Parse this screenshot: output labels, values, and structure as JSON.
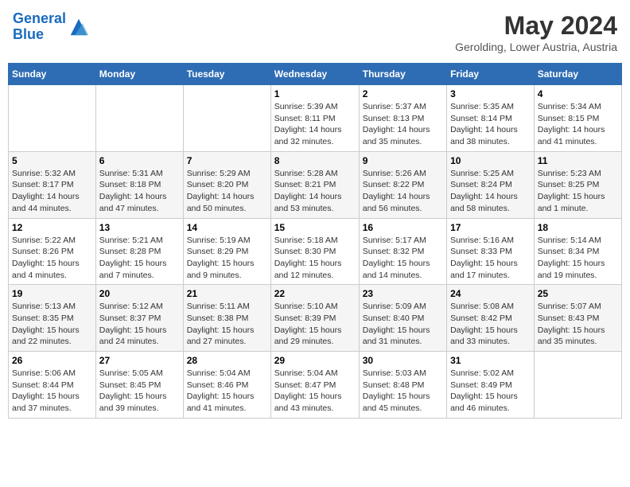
{
  "header": {
    "logo_line1": "General",
    "logo_line2": "Blue",
    "month_year": "May 2024",
    "location": "Gerolding, Lower Austria, Austria"
  },
  "calendar": {
    "days_of_week": [
      "Sunday",
      "Monday",
      "Tuesday",
      "Wednesday",
      "Thursday",
      "Friday",
      "Saturday"
    ],
    "weeks": [
      [
        {
          "num": "",
          "sunrise": "",
          "sunset": "",
          "daylight": ""
        },
        {
          "num": "",
          "sunrise": "",
          "sunset": "",
          "daylight": ""
        },
        {
          "num": "",
          "sunrise": "",
          "sunset": "",
          "daylight": ""
        },
        {
          "num": "1",
          "sunrise": "Sunrise: 5:39 AM",
          "sunset": "Sunset: 8:11 PM",
          "daylight": "Daylight: 14 hours and 32 minutes."
        },
        {
          "num": "2",
          "sunrise": "Sunrise: 5:37 AM",
          "sunset": "Sunset: 8:13 PM",
          "daylight": "Daylight: 14 hours and 35 minutes."
        },
        {
          "num": "3",
          "sunrise": "Sunrise: 5:35 AM",
          "sunset": "Sunset: 8:14 PM",
          "daylight": "Daylight: 14 hours and 38 minutes."
        },
        {
          "num": "4",
          "sunrise": "Sunrise: 5:34 AM",
          "sunset": "Sunset: 8:15 PM",
          "daylight": "Daylight: 14 hours and 41 minutes."
        }
      ],
      [
        {
          "num": "5",
          "sunrise": "Sunrise: 5:32 AM",
          "sunset": "Sunset: 8:17 PM",
          "daylight": "Daylight: 14 hours and 44 minutes."
        },
        {
          "num": "6",
          "sunrise": "Sunrise: 5:31 AM",
          "sunset": "Sunset: 8:18 PM",
          "daylight": "Daylight: 14 hours and 47 minutes."
        },
        {
          "num": "7",
          "sunrise": "Sunrise: 5:29 AM",
          "sunset": "Sunset: 8:20 PM",
          "daylight": "Daylight: 14 hours and 50 minutes."
        },
        {
          "num": "8",
          "sunrise": "Sunrise: 5:28 AM",
          "sunset": "Sunset: 8:21 PM",
          "daylight": "Daylight: 14 hours and 53 minutes."
        },
        {
          "num": "9",
          "sunrise": "Sunrise: 5:26 AM",
          "sunset": "Sunset: 8:22 PM",
          "daylight": "Daylight: 14 hours and 56 minutes."
        },
        {
          "num": "10",
          "sunrise": "Sunrise: 5:25 AM",
          "sunset": "Sunset: 8:24 PM",
          "daylight": "Daylight: 14 hours and 58 minutes."
        },
        {
          "num": "11",
          "sunrise": "Sunrise: 5:23 AM",
          "sunset": "Sunset: 8:25 PM",
          "daylight": "Daylight: 15 hours and 1 minute."
        }
      ],
      [
        {
          "num": "12",
          "sunrise": "Sunrise: 5:22 AM",
          "sunset": "Sunset: 8:26 PM",
          "daylight": "Daylight: 15 hours and 4 minutes."
        },
        {
          "num": "13",
          "sunrise": "Sunrise: 5:21 AM",
          "sunset": "Sunset: 8:28 PM",
          "daylight": "Daylight: 15 hours and 7 minutes."
        },
        {
          "num": "14",
          "sunrise": "Sunrise: 5:19 AM",
          "sunset": "Sunset: 8:29 PM",
          "daylight": "Daylight: 15 hours and 9 minutes."
        },
        {
          "num": "15",
          "sunrise": "Sunrise: 5:18 AM",
          "sunset": "Sunset: 8:30 PM",
          "daylight": "Daylight: 15 hours and 12 minutes."
        },
        {
          "num": "16",
          "sunrise": "Sunrise: 5:17 AM",
          "sunset": "Sunset: 8:32 PM",
          "daylight": "Daylight: 15 hours and 14 minutes."
        },
        {
          "num": "17",
          "sunrise": "Sunrise: 5:16 AM",
          "sunset": "Sunset: 8:33 PM",
          "daylight": "Daylight: 15 hours and 17 minutes."
        },
        {
          "num": "18",
          "sunrise": "Sunrise: 5:14 AM",
          "sunset": "Sunset: 8:34 PM",
          "daylight": "Daylight: 15 hours and 19 minutes."
        }
      ],
      [
        {
          "num": "19",
          "sunrise": "Sunrise: 5:13 AM",
          "sunset": "Sunset: 8:35 PM",
          "daylight": "Daylight: 15 hours and 22 minutes."
        },
        {
          "num": "20",
          "sunrise": "Sunrise: 5:12 AM",
          "sunset": "Sunset: 8:37 PM",
          "daylight": "Daylight: 15 hours and 24 minutes."
        },
        {
          "num": "21",
          "sunrise": "Sunrise: 5:11 AM",
          "sunset": "Sunset: 8:38 PM",
          "daylight": "Daylight: 15 hours and 27 minutes."
        },
        {
          "num": "22",
          "sunrise": "Sunrise: 5:10 AM",
          "sunset": "Sunset: 8:39 PM",
          "daylight": "Daylight: 15 hours and 29 minutes."
        },
        {
          "num": "23",
          "sunrise": "Sunrise: 5:09 AM",
          "sunset": "Sunset: 8:40 PM",
          "daylight": "Daylight: 15 hours and 31 minutes."
        },
        {
          "num": "24",
          "sunrise": "Sunrise: 5:08 AM",
          "sunset": "Sunset: 8:42 PM",
          "daylight": "Daylight: 15 hours and 33 minutes."
        },
        {
          "num": "25",
          "sunrise": "Sunrise: 5:07 AM",
          "sunset": "Sunset: 8:43 PM",
          "daylight": "Daylight: 15 hours and 35 minutes."
        }
      ],
      [
        {
          "num": "26",
          "sunrise": "Sunrise: 5:06 AM",
          "sunset": "Sunset: 8:44 PM",
          "daylight": "Daylight: 15 hours and 37 minutes."
        },
        {
          "num": "27",
          "sunrise": "Sunrise: 5:05 AM",
          "sunset": "Sunset: 8:45 PM",
          "daylight": "Daylight: 15 hours and 39 minutes."
        },
        {
          "num": "28",
          "sunrise": "Sunrise: 5:04 AM",
          "sunset": "Sunset: 8:46 PM",
          "daylight": "Daylight: 15 hours and 41 minutes."
        },
        {
          "num": "29",
          "sunrise": "Sunrise: 5:04 AM",
          "sunset": "Sunset: 8:47 PM",
          "daylight": "Daylight: 15 hours and 43 minutes."
        },
        {
          "num": "30",
          "sunrise": "Sunrise: 5:03 AM",
          "sunset": "Sunset: 8:48 PM",
          "daylight": "Daylight: 15 hours and 45 minutes."
        },
        {
          "num": "31",
          "sunrise": "Sunrise: 5:02 AM",
          "sunset": "Sunset: 8:49 PM",
          "daylight": "Daylight: 15 hours and 46 minutes."
        },
        {
          "num": "",
          "sunrise": "",
          "sunset": "",
          "daylight": ""
        }
      ]
    ]
  }
}
